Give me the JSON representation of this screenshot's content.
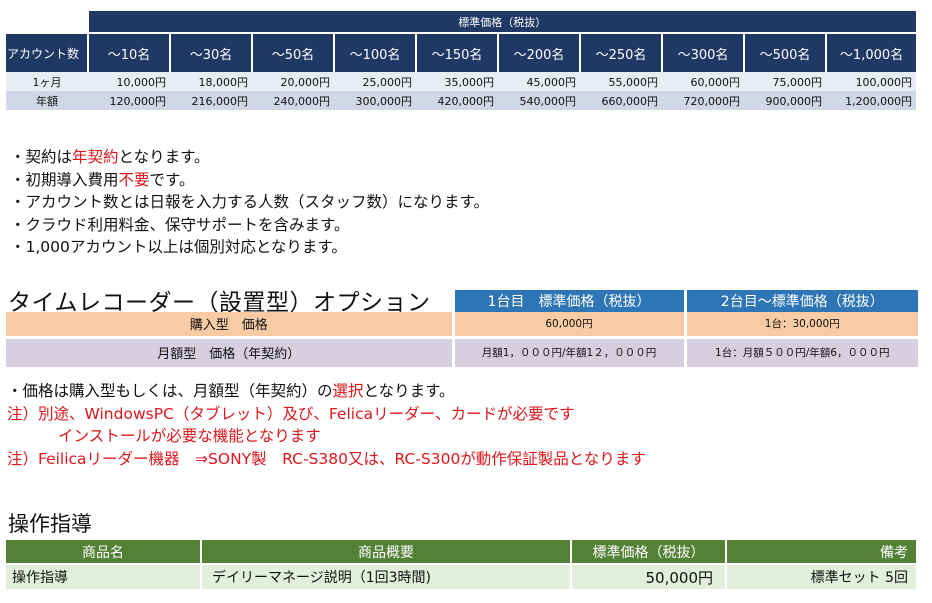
{
  "pricing": {
    "title": "標準価格（税抜）",
    "row_header": "アカウント数",
    "columns": [
      "～10名",
      "～30名",
      "～50名",
      "～100名",
      "～150名",
      "～200名",
      "～250名",
      "～300名",
      "～500名",
      "～1,000名"
    ],
    "rows": [
      {
        "label": "1ヶ月",
        "values": [
          "10,000円",
          "18,000円",
          "20,000円",
          "25,000円",
          "35,000円",
          "45,000円",
          "55,000円",
          "60,000円",
          "75,000円",
          "100,000円"
        ]
      },
      {
        "label": "年額",
        "values": [
          "120,000円",
          "216,000円",
          "240,000円",
          "300,000円",
          "420,000円",
          "540,000円",
          "660,000円",
          "720,000円",
          "900,000円",
          "1,200,000円"
        ]
      }
    ]
  },
  "notes": {
    "n1_pre": "・契約は",
    "n1_red": "年契約",
    "n1_post": "となります。",
    "n2_pre": "・初期導入費用",
    "n2_red": "不要",
    "n2_post": "です。",
    "n3": "・アカウント数とは日報を入力する人数（スタッフ数）になります。",
    "n4": "・クラウド利用料金、保守サポートを含みます。",
    "n5": "・1,000アカウント以上は個別対応となります。"
  },
  "time_recorder": {
    "title": "タイムレコーダー（設置型）オプション",
    "col1_head": "1台目　標準価格（税抜）",
    "col2_head": "2台目～標準価格（税抜）",
    "rows": [
      {
        "label": "購入型　価格",
        "col1": "60,000円",
        "col2": "1台：30,000円"
      },
      {
        "label": "月額型　価格（年契約）",
        "col1": "月額1，０００円/年額1２，０００円",
        "col2": "1台：月額５００円/年額6，０００円"
      }
    ]
  },
  "option_notes": {
    "l1_pre": "・価格は購入型もしくは、月額型（年契約）の",
    "l1_red": "選択",
    "l1_post": "となります。",
    "l2": "注）別途、WindowsPC（タブレット）及び、Felicaリーダー、カードが必要です",
    "l3": "インストールが必要な機能となります",
    "l4": "注）Feilicaリーダー機器　⇒SONY製　RC-S380又は、RC-S300が動作保証製品となります"
  },
  "training": {
    "title": "操作指導",
    "headers": [
      "商品名",
      "商品概要",
      "標準価格（税抜）",
      "備考"
    ],
    "row": {
      "name": "操作指導",
      "desc": "デイリーマネージ説明（1回3時間)",
      "price": "50,000円",
      "note": "標準セット 5回"
    }
  },
  "colors": {
    "navy": "#1f3864",
    "blue": "#2e75b6",
    "green": "#538135",
    "red": "#e0161b",
    "orange_row": "#f8cba4",
    "lavender_row": "#d5cfe0",
    "light_green": "#e2efda"
  }
}
